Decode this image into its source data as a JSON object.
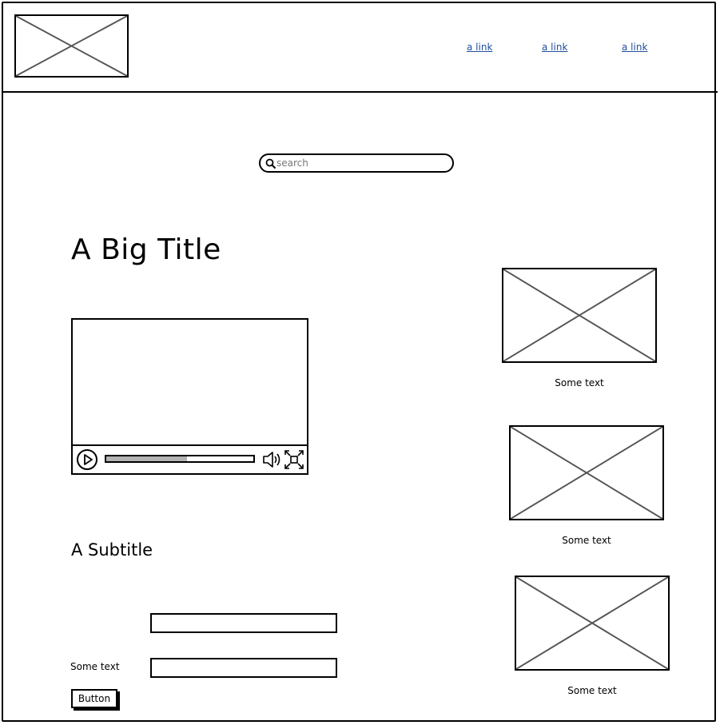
{
  "header": {
    "logo_icon": "image-placeholder-icon",
    "nav_links": [
      "a link",
      "a link",
      "a link"
    ],
    "link_color": "#1f4e9c"
  },
  "search": {
    "placeholder": "search",
    "icon": "search-icon"
  },
  "main": {
    "title": "A Big Title",
    "video": {
      "progress": 0.55,
      "controls": [
        "play-icon",
        "volume-icon",
        "fullscreen-icon"
      ]
    },
    "subtitle": "A Subtitle",
    "form": {
      "label": "Some text",
      "button_label": "Button"
    }
  },
  "sidebar": {
    "images": [
      {
        "caption": "Some text"
      },
      {
        "caption": "Some text"
      },
      {
        "caption": "Some text"
      }
    ]
  }
}
